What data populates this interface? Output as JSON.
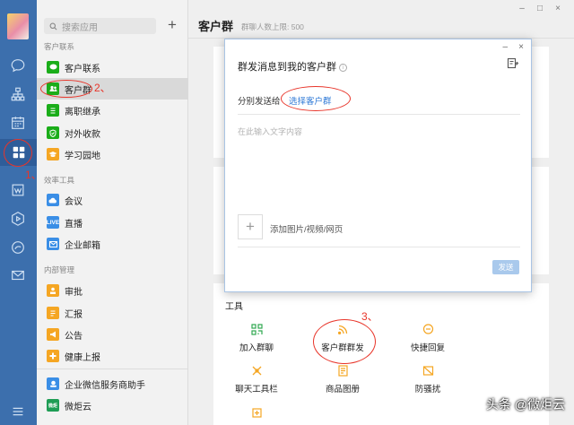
{
  "sidebar": {
    "search_placeholder": "搜索应用",
    "add_symbol": "+",
    "sections": [
      {
        "title": "客户联系",
        "items": [
          {
            "label": "客户联系",
            "icon": "chat-icon",
            "color": "#1aad19"
          },
          {
            "label": "客户群",
            "icon": "group-icon",
            "color": "#1aad19"
          },
          {
            "label": "离职继承",
            "icon": "document-icon",
            "color": "#1aad19"
          },
          {
            "label": "对外收款",
            "icon": "shield-icon",
            "color": "#1aad19"
          },
          {
            "label": "学习园地",
            "icon": "graduation-cap-icon",
            "color": "#f5a623"
          }
        ]
      },
      {
        "title": "效率工具",
        "items": [
          {
            "label": "会议",
            "icon": "cloud-icon",
            "color": "#3a8ee6"
          },
          {
            "label": "直播",
            "icon": "live-icon",
            "color": "#3a8ee6",
            "badge": "LIVE"
          },
          {
            "label": "企业邮箱",
            "icon": "mail-icon",
            "color": "#3a8ee6"
          }
        ]
      },
      {
        "title": "内部管理",
        "items": [
          {
            "label": "审批",
            "icon": "approval-icon",
            "color": "#f5a623"
          },
          {
            "label": "汇报",
            "icon": "report-icon",
            "color": "#f5a623"
          },
          {
            "label": "公告",
            "icon": "megaphone-icon",
            "color": "#f5a623"
          },
          {
            "label": "健康上报",
            "icon": "health-icon",
            "color": "#f5a623"
          }
        ]
      }
    ],
    "extra_items": [
      {
        "label": "企业微信服务商助手",
        "icon": "assistant-icon",
        "color": "#3a8ee6"
      },
      {
        "label": "微炬云",
        "icon": "weiju-logo-icon",
        "color": "#1f9d55",
        "logo_text": "微炬"
      }
    ]
  },
  "main": {
    "title": "客户群",
    "subtitle": "群聊人数上限: 500",
    "window_controls": [
      "–",
      "□",
      "×"
    ],
    "tools_title": "工具",
    "tools": [
      {
        "label": "加入群聊",
        "icon": "qrcode-icon"
      },
      {
        "label": "客户群群发",
        "icon": "rss-icon"
      },
      {
        "label": "快捷回复",
        "icon": "bubble-icon"
      },
      {
        "label": "聊天工具栏",
        "icon": "toolbar-icon"
      },
      {
        "label": "商品图册",
        "icon": "catalog-icon"
      },
      {
        "label": "防骚扰",
        "icon": "no-spam-icon"
      }
    ]
  },
  "dialog": {
    "title": "群发消息到我的客户群",
    "send_to_label": "分别发送给",
    "select_link": "选择客户群",
    "message_placeholder": "在此输入文字内容",
    "add_media_label": "添加图片/视频/网页",
    "send_button": "发送",
    "controls": [
      "–",
      "×"
    ]
  },
  "annotations": {
    "labels": [
      "1、",
      "2、",
      "3、"
    ],
    "color": "#e8352a"
  },
  "watermark": {
    "text": "头条 @微炬云"
  },
  "colors": {
    "rail": "#3c6fad",
    "link": "#2d78d6",
    "accent_green": "#1aad19",
    "accent_orange": "#f5a623"
  }
}
